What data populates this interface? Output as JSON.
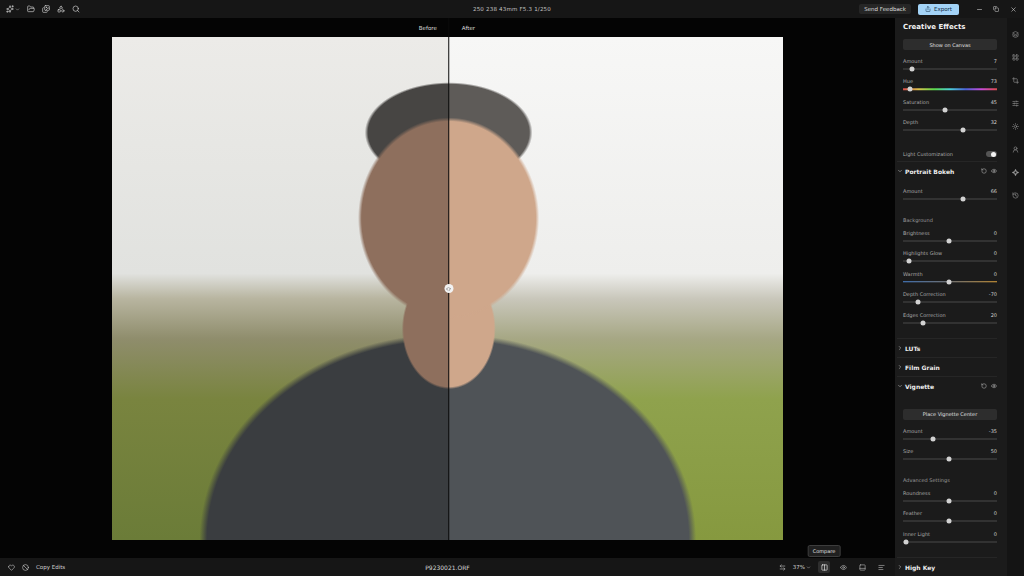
{
  "toolbar": {
    "exif": "250 238 43mm F5.3 1/250",
    "feedback": "Send Feedback",
    "export": "Export"
  },
  "canvas": {
    "before": "Before",
    "after": "After",
    "level": 0.502
  },
  "panel": {
    "title": "Creative Effects",
    "items": [
      {
        "kind": "button",
        "label": "Show on Canvas"
      },
      {
        "kind": "slider",
        "label": "Amount",
        "value": "7",
        "level": 0.1
      },
      {
        "kind": "hue-slider",
        "label": "Hue",
        "value": "73",
        "level": 0.07
      },
      {
        "kind": "slider",
        "label": "Saturation",
        "value": "45",
        "level": 0.45
      },
      {
        "kind": "slider",
        "label": "Depth",
        "value": "32",
        "level": 0.64
      },
      {
        "kind": "toggle",
        "label": "Light Customization",
        "on": true
      }
    ],
    "sections": [
      {
        "title": "Portrait Bokeh",
        "expanded": true,
        "items": [
          {
            "kind": "slider",
            "label": "Amount",
            "value": "66",
            "level": 0.64
          },
          {
            "kind": "subheader",
            "label": "Background"
          },
          {
            "kind": "slider",
            "label": "Brightness",
            "value": "0",
            "level": 0.49
          },
          {
            "kind": "slider",
            "label": "Highlights Glow",
            "value": "0",
            "level": 0.06
          },
          {
            "kind": "warmth-slider",
            "label": "Warmth",
            "value": "0",
            "level": 0.49
          },
          {
            "kind": "slider",
            "label": "Depth Correction",
            "value": "-70",
            "level": 0.16
          },
          {
            "kind": "slider",
            "label": "Edges Correction",
            "value": "20",
            "level": 0.21
          }
        ]
      },
      {
        "title": "LUTs",
        "expanded": false,
        "items": []
      },
      {
        "title": "Film Grain",
        "expanded": false,
        "items": []
      },
      {
        "title": "Vignette",
        "expanded": true,
        "items": [
          {
            "kind": "button",
            "label": "Place Vignette Center"
          },
          {
            "kind": "slider",
            "label": "Amount",
            "value": "-35",
            "level": 0.32
          },
          {
            "kind": "slider",
            "label": "Size",
            "value": "50",
            "level": 0.49
          },
          {
            "kind": "subheader",
            "label": "Advanced Settings"
          },
          {
            "kind": "slider",
            "label": "Roundness",
            "value": "0",
            "level": 0.49
          },
          {
            "kind": "slider",
            "label": "Feather",
            "value": "0",
            "level": 0.49
          },
          {
            "kind": "slider",
            "label": "Inner Light",
            "value": "0",
            "level": 0.03
          }
        ]
      },
      {
        "title": "High Key",
        "expanded": false,
        "items": []
      }
    ]
  },
  "tool_strip": [
    {
      "selected": false
    },
    {
      "selected": false
    },
    {
      "selected": false
    },
    {
      "selected": false
    },
    {
      "selected": false
    },
    {
      "selected": false
    },
    {
      "selected": true
    },
    {
      "selected": false
    }
  ],
  "bottom_bar": {
    "favorite": false,
    "copy": "Copy Edits",
    "file": "P9230021.ORF",
    "zoom": "37%",
    "tooltip": "Compare",
    "view_tools": [
      {
        "selected": true
      },
      {
        "selected": false
      },
      {
        "selected": false
      },
      {
        "selected": false
      }
    ]
  }
}
